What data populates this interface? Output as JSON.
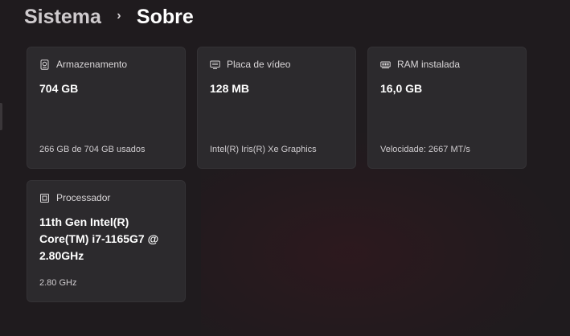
{
  "breadcrumb": {
    "parent": "Sistema",
    "separator": "›",
    "current": "Sobre"
  },
  "cards": {
    "storage": {
      "icon": "storage-icon",
      "title": "Armazenamento",
      "value": "704 GB",
      "detail": "266 GB de 704 GB usados"
    },
    "gpu": {
      "icon": "monitor-icon",
      "title": "Placa de vídeo",
      "value": "128 MB",
      "detail": "Intel(R) Iris(R) Xe Graphics"
    },
    "ram": {
      "icon": "ram-icon",
      "title": "RAM instalada",
      "value": "16,0 GB",
      "detail": "Velocidade: 2667 MT/s"
    },
    "cpu": {
      "icon": "processor-icon",
      "title": "Processador",
      "value_lines": [
        "11th Gen Intel(R)",
        "Core(TM) i7-1165G7 @",
        "2.80GHz"
      ],
      "detail": "2.80 GHz"
    }
  },
  "colors": {
    "background": "#1f1b1e",
    "card": "#2c2a2d",
    "text_primary": "#ffffff",
    "text_secondary": "#cfcccf"
  }
}
